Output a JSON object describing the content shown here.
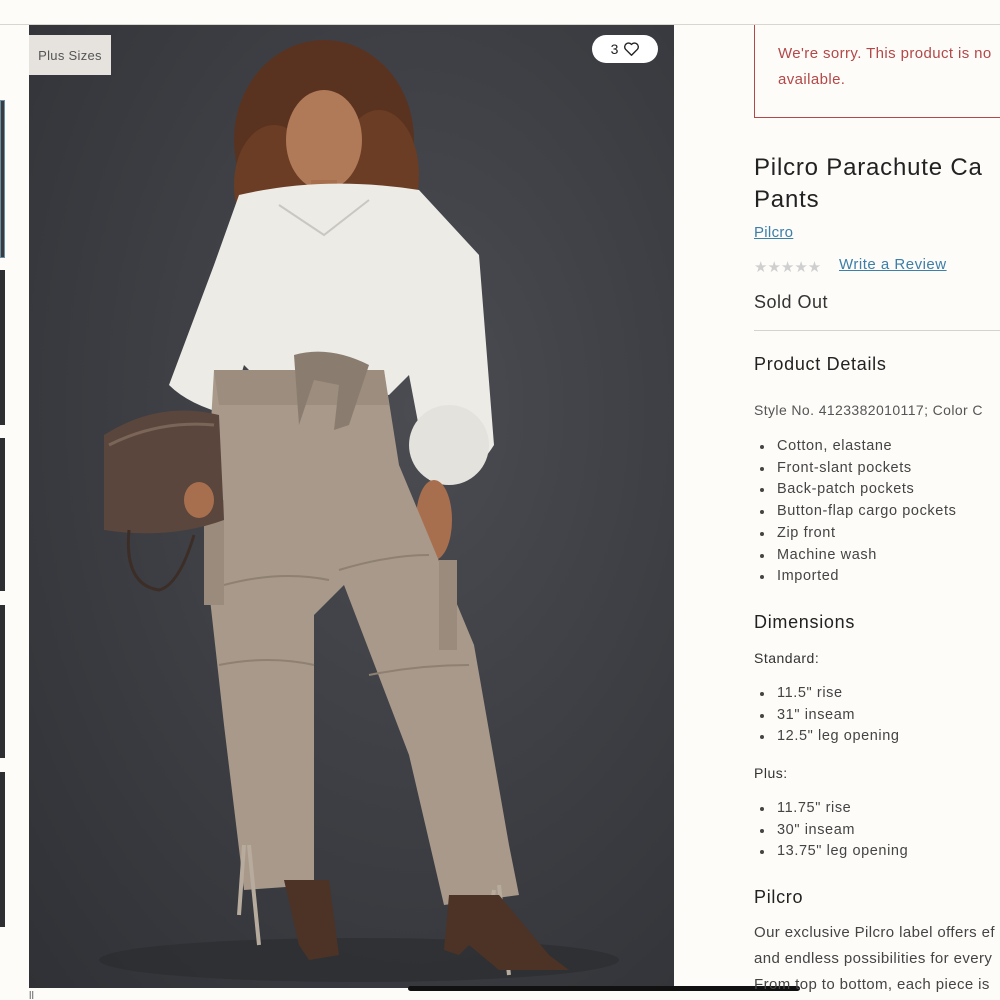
{
  "hero": {
    "badge": "Plus Sizes",
    "favorite_count": "3",
    "caption_bottom": "ll"
  },
  "alert": {
    "line1": "We're sorry. This product is no",
    "line2": "available."
  },
  "product": {
    "title_line1": "Pilcro Parachute Ca",
    "title_line2": "Pants",
    "brand": "Pilcro",
    "stars": "★★★★★",
    "rating_fraction": 0,
    "write_review": "Write a Review",
    "status": "Sold Out"
  },
  "details": {
    "heading": "Product Details",
    "style_no": "Style No. 4123382010117; Color C",
    "features": [
      "Cotton, elastane",
      "Front-slant pockets",
      "Back-patch pockets",
      "Button-flap cargo pockets",
      "Zip front",
      "Machine wash",
      "Imported"
    ]
  },
  "dimensions": {
    "heading": "Dimensions",
    "standard_label": "Standard:",
    "standard": [
      "11.5\" rise",
      "31\" inseam",
      "12.5\" leg opening"
    ],
    "plus_label": "Plus:",
    "plus": [
      "11.75\" rise",
      "30\" inseam",
      "13.75\" leg opening"
    ]
  },
  "about": {
    "heading": "Pilcro",
    "line1": "Our exclusive Pilcro label offers ef",
    "line2": "and endless possibilities for every",
    "line3": "From top to bottom, each piece is"
  },
  "colors": {
    "alert_red": "#b34848",
    "link_blue": "#3c7fa8",
    "background": "#fdfcf9"
  }
}
